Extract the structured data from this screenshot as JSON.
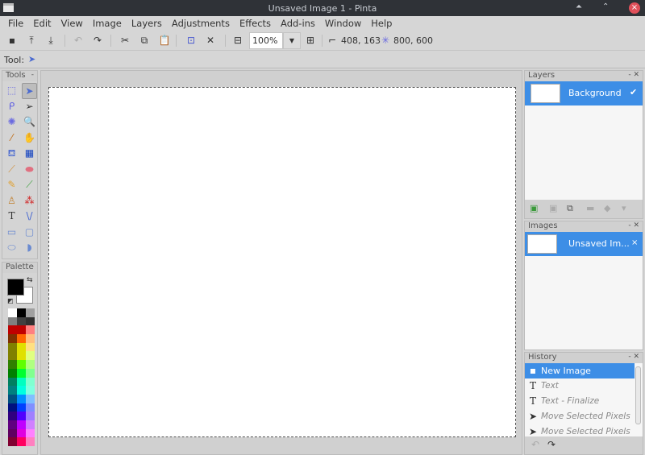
{
  "window": {
    "title": "Unsaved Image 1 - Pinta",
    "controls": [
      "minimize-icon",
      "maximize-icon",
      "close-icon"
    ]
  },
  "menu": [
    "File",
    "Edit",
    "View",
    "Image",
    "Layers",
    "Adjustments",
    "Effects",
    "Add-ins",
    "Window",
    "Help"
  ],
  "toolbar": {
    "zoom": "100%",
    "cursor_pos": "408, 163",
    "image_size": "800, 600"
  },
  "tool_row": {
    "label": "Tool:"
  },
  "tools_panel": {
    "title": "Tools",
    "collapse": "-",
    "tools": [
      "rectangle-select",
      "move-selected",
      "lasso-select",
      "move-selection",
      "magic-wand",
      "zoom",
      "color-picker",
      "pan",
      "paint-bucket",
      "gradient",
      "paintbrush",
      "eraser",
      "pencil",
      "color-dropper",
      "clone-stamp",
      "recolor",
      "text",
      "line-curve",
      "rectangle",
      "rounded-rectangle",
      "ellipse",
      "freeform-shape"
    ],
    "selected": "move-selected"
  },
  "palette_panel": {
    "title": "Palette",
    "collapse": "-",
    "primary": "#000000",
    "secondary": "#ffffff",
    "colors": [
      "#ffffff",
      "#000000",
      "#a0a0a0",
      "#808080",
      "#404040",
      "#303030",
      "#c00000",
      "#c00000",
      "#ff8080",
      "#803000",
      "#ff6600",
      "#ffc080",
      "#808000",
      "#e0e000",
      "#ffe080",
      "#808000",
      "#e0e000",
      "#e0ff80",
      "#308000",
      "#60ff00",
      "#b0ff80",
      "#008000",
      "#00ff30",
      "#80ff90",
      "#008060",
      "#00ffc0",
      "#80ffd0",
      "#008080",
      "#00ffe0",
      "#80ffe0",
      "#005080",
      "#0090ff",
      "#80c0ff",
      "#001080",
      "#0040ff",
      "#8090ff",
      "#300080",
      "#5000ff",
      "#a080ff",
      "#600080",
      "#c000ff",
      "#d080ff",
      "#600060",
      "#e000e0",
      "#ff80ff",
      "#800030",
      "#ff0060",
      "#ff80c0"
    ]
  },
  "layers_panel": {
    "title": "Layers",
    "layers": [
      {
        "name": "Background",
        "visible": true
      }
    ]
  },
  "images_panel": {
    "title": "Images",
    "images": [
      {
        "name": "Unsaved Im..."
      }
    ]
  },
  "history_panel": {
    "title": "History",
    "items": [
      "New Image",
      "Text",
      "Text - Finalize",
      "Move Selected Pixels",
      "Move Selected Pixels"
    ],
    "current": 0
  },
  "accent": "#3d8ee6"
}
